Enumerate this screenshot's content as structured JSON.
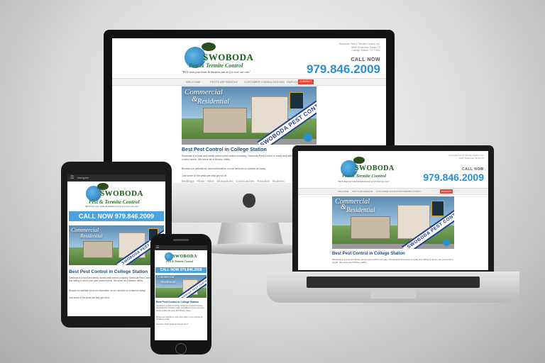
{
  "brand": {
    "name": "SWOBODA",
    "subtitle": "Pest & Termite Control",
    "subtitle_suffix": "Inc.",
    "tagline": "\"We'll treat your home & business just as if it were our own\"",
    "colors": {
      "phone": "#2b8fd0",
      "contact_button": "#e14b3b",
      "heading": "#1e4a7a",
      "cta": "#4aa3df"
    }
  },
  "header": {
    "call_label": "CALL NOW",
    "phone": "979.846.2009",
    "address": [
      "Swoboda Pest & Termite Control, Inc.",
      "3608 Texas Ave, Bryan TX",
      "College Station, TX 77802"
    ]
  },
  "nav": {
    "items": [
      "WELCOME",
      "PESTS WE REMOVE",
      "CUSTOMER CONSULTATIONS",
      "EMPLOYMENT"
    ],
    "contact": "CONTACT US",
    "mobile_menu": "Navigate"
  },
  "hero": {
    "commercial": "Commercial",
    "amp": "&",
    "residential": "Residential",
    "banner": "SWOBODA PEST CONTROL"
  },
  "content": {
    "heading": "Best Pest Control in College Station",
    "paragraph1": "Swoboda is a local and family owned pest control company. Swoboda Pest Control is ready and willing to serve your pest control needs. We serve all of Brazos Valley.",
    "paragraph2": "Browse our website for more information on our services or contact us today.",
    "paragraph3": "Just some of the pests we help get rid of:",
    "pests": [
      "Bedbugs",
      "Fleas",
      "Mice",
      "Mosquitoes",
      "Cockroaches",
      "Roaches",
      "Rodents"
    ]
  },
  "mobile": {
    "cta": "CALL NOW 979.846.2009"
  },
  "devices": [
    "desktop",
    "laptop",
    "tablet",
    "phone"
  ]
}
